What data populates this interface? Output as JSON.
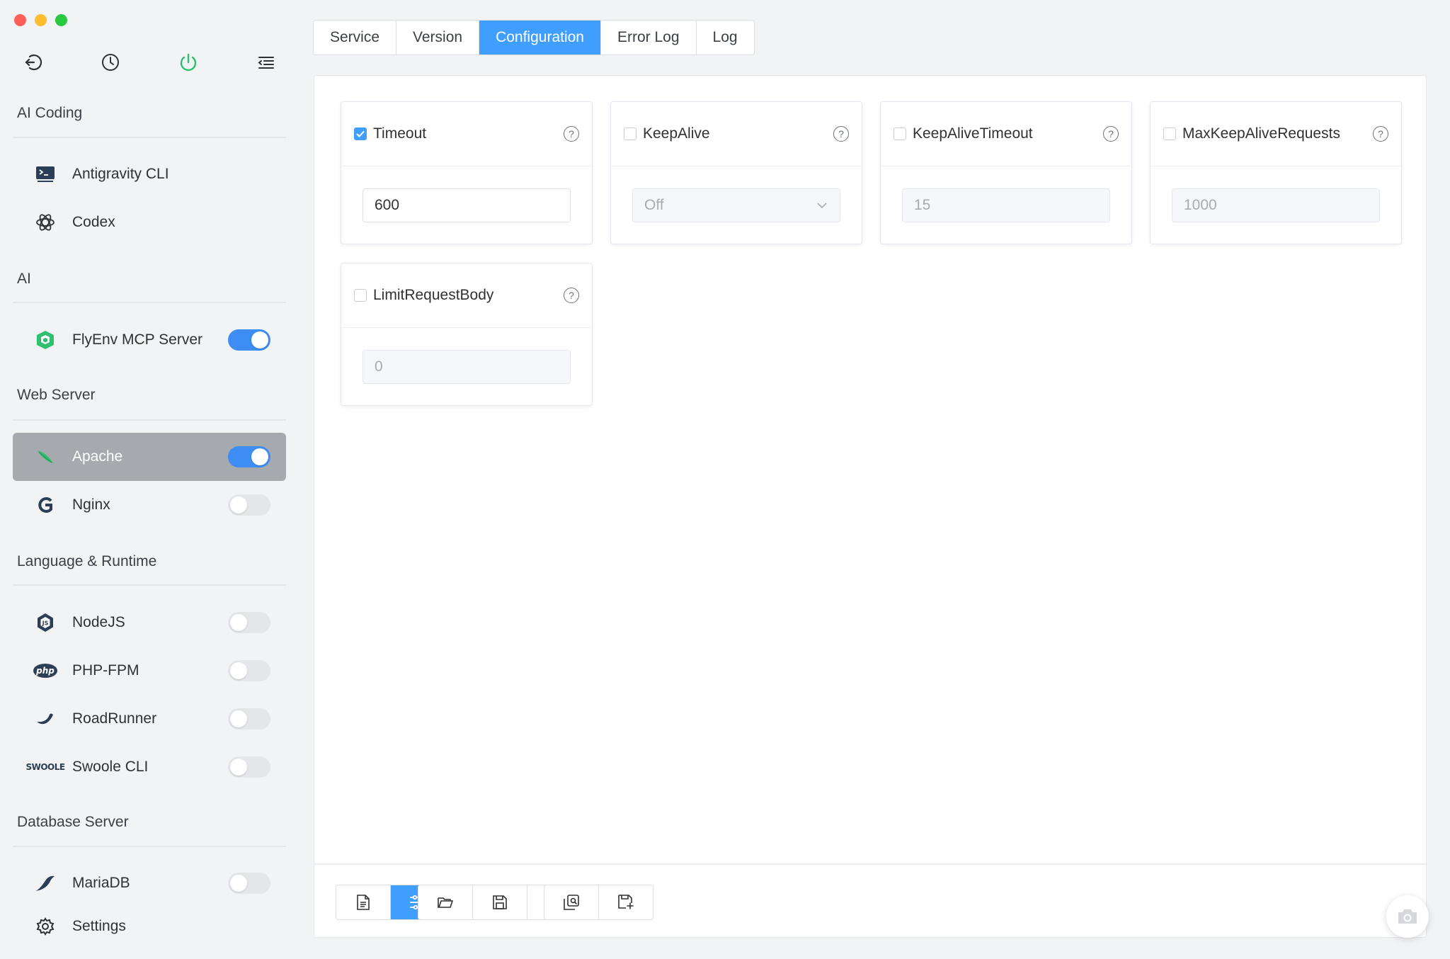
{
  "sidebar": {
    "top_icons": [
      "back-icon",
      "history-icon",
      "power-icon",
      "menu-icon"
    ],
    "groups": {
      "ai_coding": "AI Coding",
      "ai": "AI",
      "web_server": "Web Server",
      "language_runtime": "Language & Runtime",
      "database_server": "Database Server"
    },
    "items": {
      "antigravity": "Antigravity CLI",
      "codex": "Codex",
      "flyenv_mcp": "FlyEnv MCP Server",
      "apache": "Apache",
      "nginx": "Nginx",
      "nodejs": "NodeJS",
      "php_fpm": "PHP-FPM",
      "roadrunner": "RoadRunner",
      "swoole": "Swoole CLI",
      "mariadb": "MariaDB",
      "settings": "Settings"
    },
    "icon_text": {
      "php": "php",
      "swoole": "SWOOLE"
    },
    "toggles": {
      "flyenv_mcp": true,
      "apache": true,
      "nginx": false,
      "nodejs": false,
      "php_fpm": false,
      "roadrunner": false,
      "swoole": false,
      "mariadb": false
    }
  },
  "tabs": [
    {
      "label": "Service",
      "active": false
    },
    {
      "label": "Version",
      "active": false
    },
    {
      "label": "Configuration",
      "active": true
    },
    {
      "label": "Error Log",
      "active": false
    },
    {
      "label": "Log",
      "active": false
    }
  ],
  "config": {
    "help_glyph": "?",
    "timeout": {
      "label": "Timeout",
      "checked": true,
      "value": "600"
    },
    "keepalive": {
      "label": "KeepAlive",
      "checked": false,
      "value": "Off"
    },
    "keepalive_timeout": {
      "label": "KeepAliveTimeout",
      "checked": false,
      "value": "15"
    },
    "max_keepalive_requests": {
      "label": "MaxKeepAliveRequests",
      "checked": false,
      "value": "1000"
    },
    "limit_request_body": {
      "label": "LimitRequestBody",
      "checked": false,
      "value": "0"
    }
  },
  "toolbar": {
    "buttons": [
      "document-icon",
      "sliders-icon",
      "folder-icon",
      "save-icon",
      "history-list-icon",
      "search-file-icon",
      "save-as-icon"
    ],
    "active": "sliders-icon"
  },
  "colors": {
    "accent": "#409eff",
    "toggle_on": "#3d8df5",
    "power_green": "#2fbf71",
    "sidebar_active": "#a6a9ad"
  }
}
